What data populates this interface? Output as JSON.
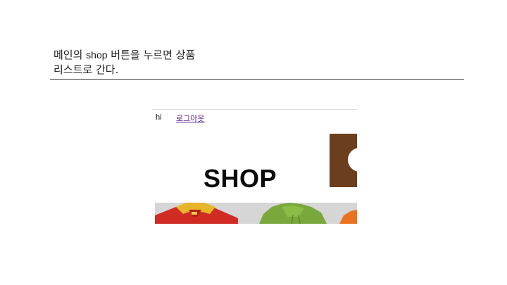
{
  "slide": {
    "title_part1": "메인의 ",
    "title_shop": "shop",
    "title_part2": " 버튼을 누르면 상품",
    "title_line2": "리스트로 간다."
  },
  "screenshot": {
    "greeting": "hi",
    "logout": "로그아웃",
    "shop_label": "SHOP"
  },
  "colors": {
    "link": "#551a8b",
    "brown_box": "#6b3f1e",
    "footer": "#2b2b2b"
  }
}
